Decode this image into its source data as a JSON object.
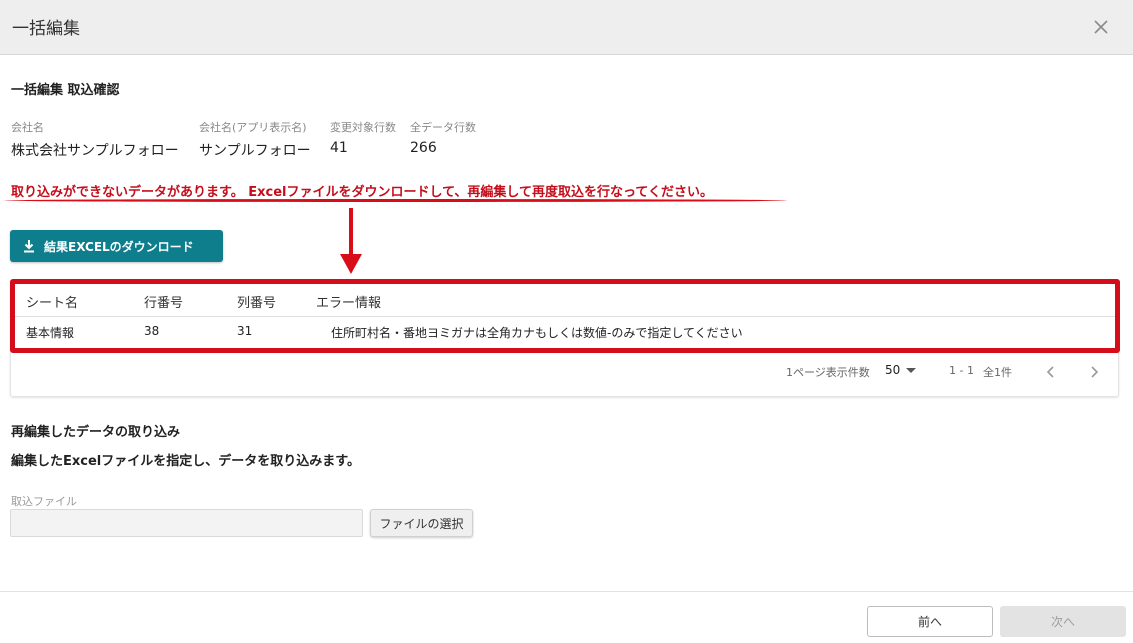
{
  "dialog": {
    "title": "一括編集",
    "close_icon": "close-icon"
  },
  "section_title": "一括編集 取込確認",
  "info": {
    "company": {
      "label": "会社名",
      "value": "株式会社サンプルフォロー"
    },
    "app_name": {
      "label": "会社名(アプリ表示名)",
      "value": "サンプルフォロー"
    },
    "changed_rows": {
      "label": "変更対象行数",
      "value": "41"
    },
    "total_rows": {
      "label": "全データ行数",
      "value": "266"
    }
  },
  "error_message": "取り込みができないデータがあります。 Excelファイルをダウンロードして、再編集して再度取込を行なってください。",
  "download_button": {
    "label": "結果EXCELのダウンロード",
    "icon": "download-icon"
  },
  "error_table": {
    "columns": [
      "シート名",
      "行番号",
      "列番号",
      "エラー情報"
    ],
    "rows": [
      [
        "基本情報",
        "38",
        "31",
        "住所町村名・番地ヨミガナは全角カナもしくは数値-のみで指定してください"
      ]
    ]
  },
  "pagination": {
    "rows_per_page_label": "1ページ表示件数",
    "rows_per_page": "50",
    "range": "1 - 1",
    "total": "全1件",
    "prev_icon": "chevron-left-icon",
    "next_icon": "chevron-right-icon"
  },
  "reupload": {
    "title": "再編集したデータの取り込み",
    "description": "編集したExcelファイルを指定し、データを取り込みます。",
    "file_label": "取込ファイル",
    "file_value": "",
    "select_button": "ファイルの選択"
  },
  "footer": {
    "prev_label": "前へ",
    "next_label": "次へ"
  },
  "colors": {
    "header_bg": "#eeeeee",
    "error_red": "#c40e1b",
    "annotation_red": "#d50c19",
    "primary_teal": "#0e7d8c"
  }
}
